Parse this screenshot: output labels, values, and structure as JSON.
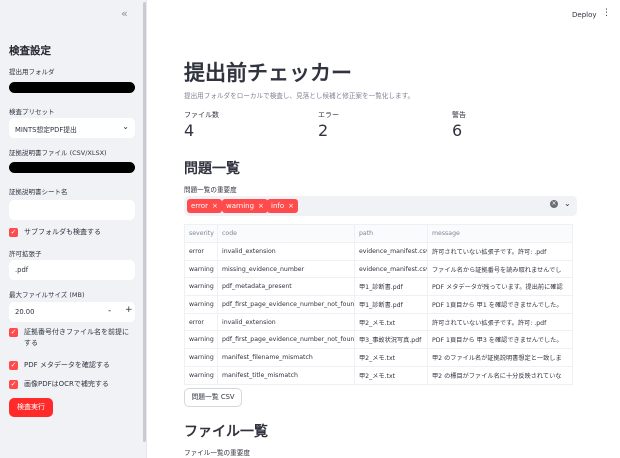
{
  "sidebar": {
    "collapse_icon": "«",
    "title": "検査設定",
    "folder_label": "提出用フォルダ",
    "preset_label": "検査プリセット",
    "preset_value": "MINTS想定PDF提出",
    "evidence_file_label": "証拠説明書ファイル (CSV/XLSX)",
    "sheet_label": "証拠説明書シート名",
    "sheet_value": "",
    "subfolder_label": "サブフォルダも検査する",
    "allowed_ext_label": "許可拡張子",
    "allowed_ext_value": ".pdf",
    "max_size_label": "最大ファイルサイズ (MB)",
    "max_size_value": "20.00",
    "minus": "-",
    "plus": "+",
    "cb_prefix_label": "証拠番号付きファイル名を前提にする",
    "cb_meta_label": "PDF メタデータを確認する",
    "cb_ocr_label": "画像PDFはOCRで補完する",
    "run_button": "検査実行"
  },
  "header": {
    "deploy": "Deploy",
    "menu_icon": "⋮"
  },
  "main": {
    "title": "提出前チェッカー",
    "caption": "提出用フォルダをローカルで検査し、見落とし候補と修正案を一覧化します。",
    "metrics": [
      {
        "label": "ファイル数",
        "value": "4"
      },
      {
        "label": "エラー",
        "value": "2"
      },
      {
        "label": "警告",
        "value": "6"
      }
    ],
    "issues_heading": "問題一覧",
    "severity_label": "問題一覧の重要度",
    "tags": [
      "error",
      "warning",
      "info"
    ],
    "columns": [
      "severity",
      "code",
      "path",
      "message"
    ],
    "rows": [
      [
        "error",
        "invalid_extension",
        "evidence_manifest.csv",
        "許可されていない拡張子です。許可: .pdf"
      ],
      [
        "warning",
        "missing_evidence_number",
        "evidence_manifest.csv",
        "ファイル名から証拠番号を読み取れませんでし"
      ],
      [
        "warning",
        "pdf_metadata_present",
        "甲1_診断書.pdf",
        "PDF メタデータが残っています。提出前に確認"
      ],
      [
        "warning",
        "pdf_first_page_evidence_number_not_found",
        "甲1_診断書.pdf",
        "PDF 1頁目から 甲1 を確認できませんでした。"
      ],
      [
        "error",
        "invalid_extension",
        "甲2_メモ.txt",
        "許可されていない拡張子です。許可: .pdf"
      ],
      [
        "warning",
        "pdf_first_page_evidence_number_not_found",
        "甲3_事故状況写真.pdf",
        "PDF 1頁目から 甲3 を確認できませんでした。"
      ],
      [
        "warning",
        "manifest_filename_mismatch",
        "甲2_メモ.txt",
        "甲2 のファイル名が証拠説明書想定と一致しま"
      ],
      [
        "warning",
        "manifest_title_mismatch",
        "甲2_メモ.txt",
        "甲2 の標目がファイル名に十分反映されていな"
      ]
    ],
    "csv_button": "問題一覧 CSV",
    "files_heading": "ファイル一覧",
    "files_caption": "ファイル一覧の重要度"
  },
  "colors": {
    "accent": "#ff4b4b",
    "sidebar_bg": "#f0f2f6"
  }
}
